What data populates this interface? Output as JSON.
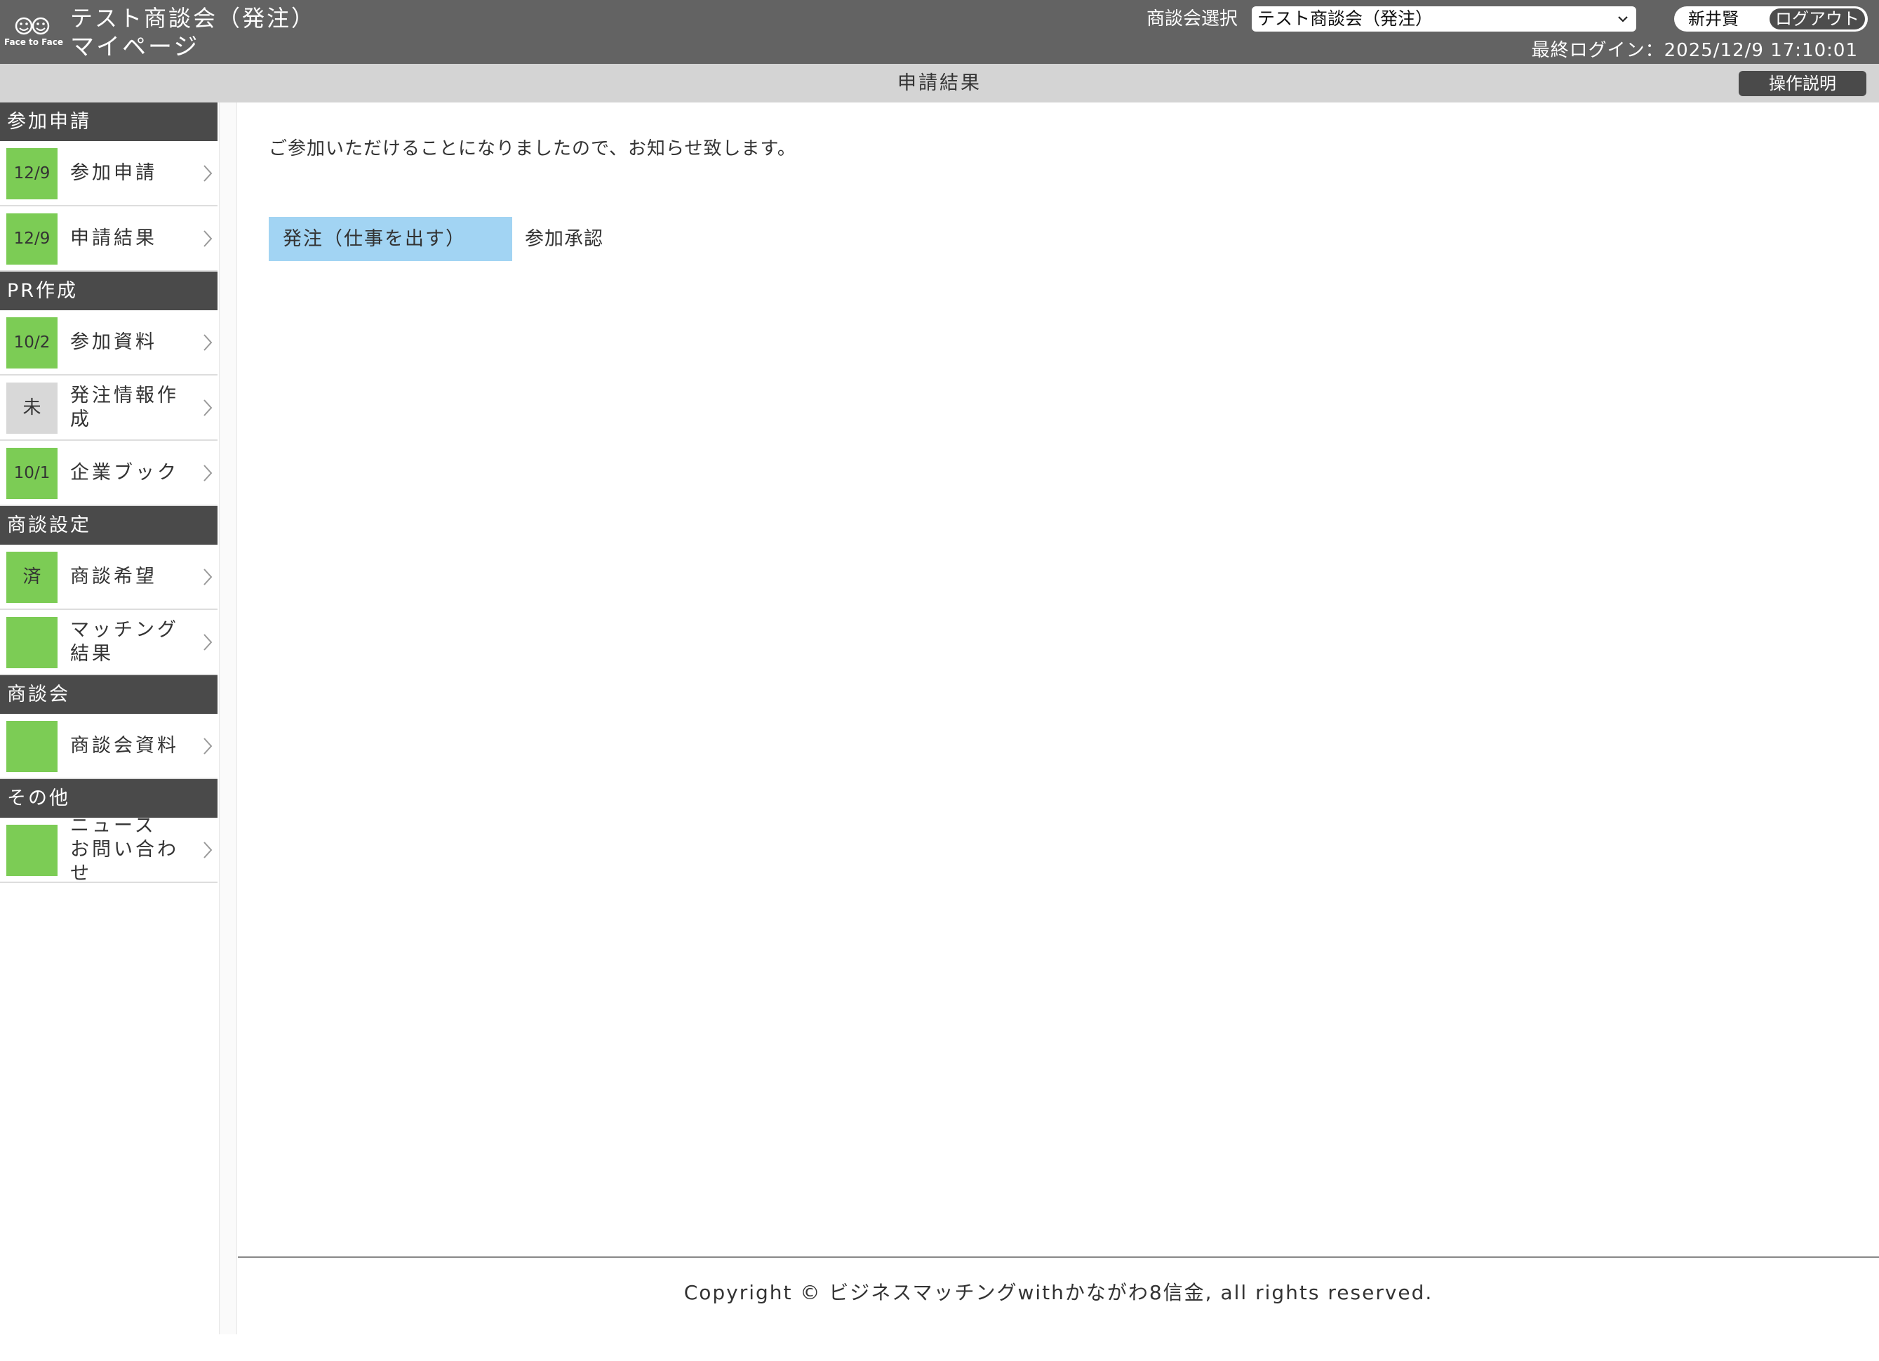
{
  "header": {
    "logo_text": "Face to Face",
    "title": "テスト商談会（発注）",
    "subtitle": "マイページ",
    "session_select_label": "商談会選択",
    "session_selected": "テスト商談会（発注）",
    "user_name": "新井賢",
    "logout_label": "ログアウト",
    "last_login": "最終ログイン：2025/12/9 17:10:01"
  },
  "subheader": {
    "page_title": "申請結果",
    "help_label": "操作説明"
  },
  "sidebar": {
    "sections": [
      {
        "title": "参加申請",
        "items": [
          {
            "badge": "12/9",
            "label": "参加申請"
          },
          {
            "badge": "12/9",
            "label": "申請結果"
          }
        ]
      },
      {
        "title": "PR作成",
        "items": [
          {
            "badge": "10/2",
            "label": "参加資料"
          },
          {
            "badge": "未",
            "label": "発注情報作成"
          },
          {
            "badge": "10/1",
            "label": "企業ブック"
          }
        ]
      },
      {
        "title": "商談設定",
        "items": [
          {
            "badge": "済",
            "label": "商談希望"
          },
          {
            "badge": "",
            "label": "マッチング\n結果"
          }
        ]
      },
      {
        "title": "商談会",
        "items": [
          {
            "badge": "",
            "label": "商談会資料"
          }
        ]
      },
      {
        "title": "その他",
        "items": [
          {
            "badge": "",
            "label": "ニュース\nお問い合わせ"
          }
        ]
      }
    ]
  },
  "main": {
    "notice": "ご参加いただけることになりましたので、お知らせ致します。",
    "result_label": "発注（仕事を出す）",
    "result_value": "参加承認"
  },
  "footer": {
    "copyright": "Copyright © ビジネスマッチングwithかながわ8信金, all rights reserved."
  },
  "colors": {
    "header_bg": "#636363",
    "subheader_bg": "#d4d4d4",
    "section_bg": "#4a4a4a",
    "badge_green": "#7ccc55",
    "badge_gray": "#d8d8d8",
    "result_tag_bg": "#a2d4f3"
  },
  "icons": [
    "face-to-face-logo-icon",
    "chevron-down-icon",
    "chevron-right-icon"
  ]
}
